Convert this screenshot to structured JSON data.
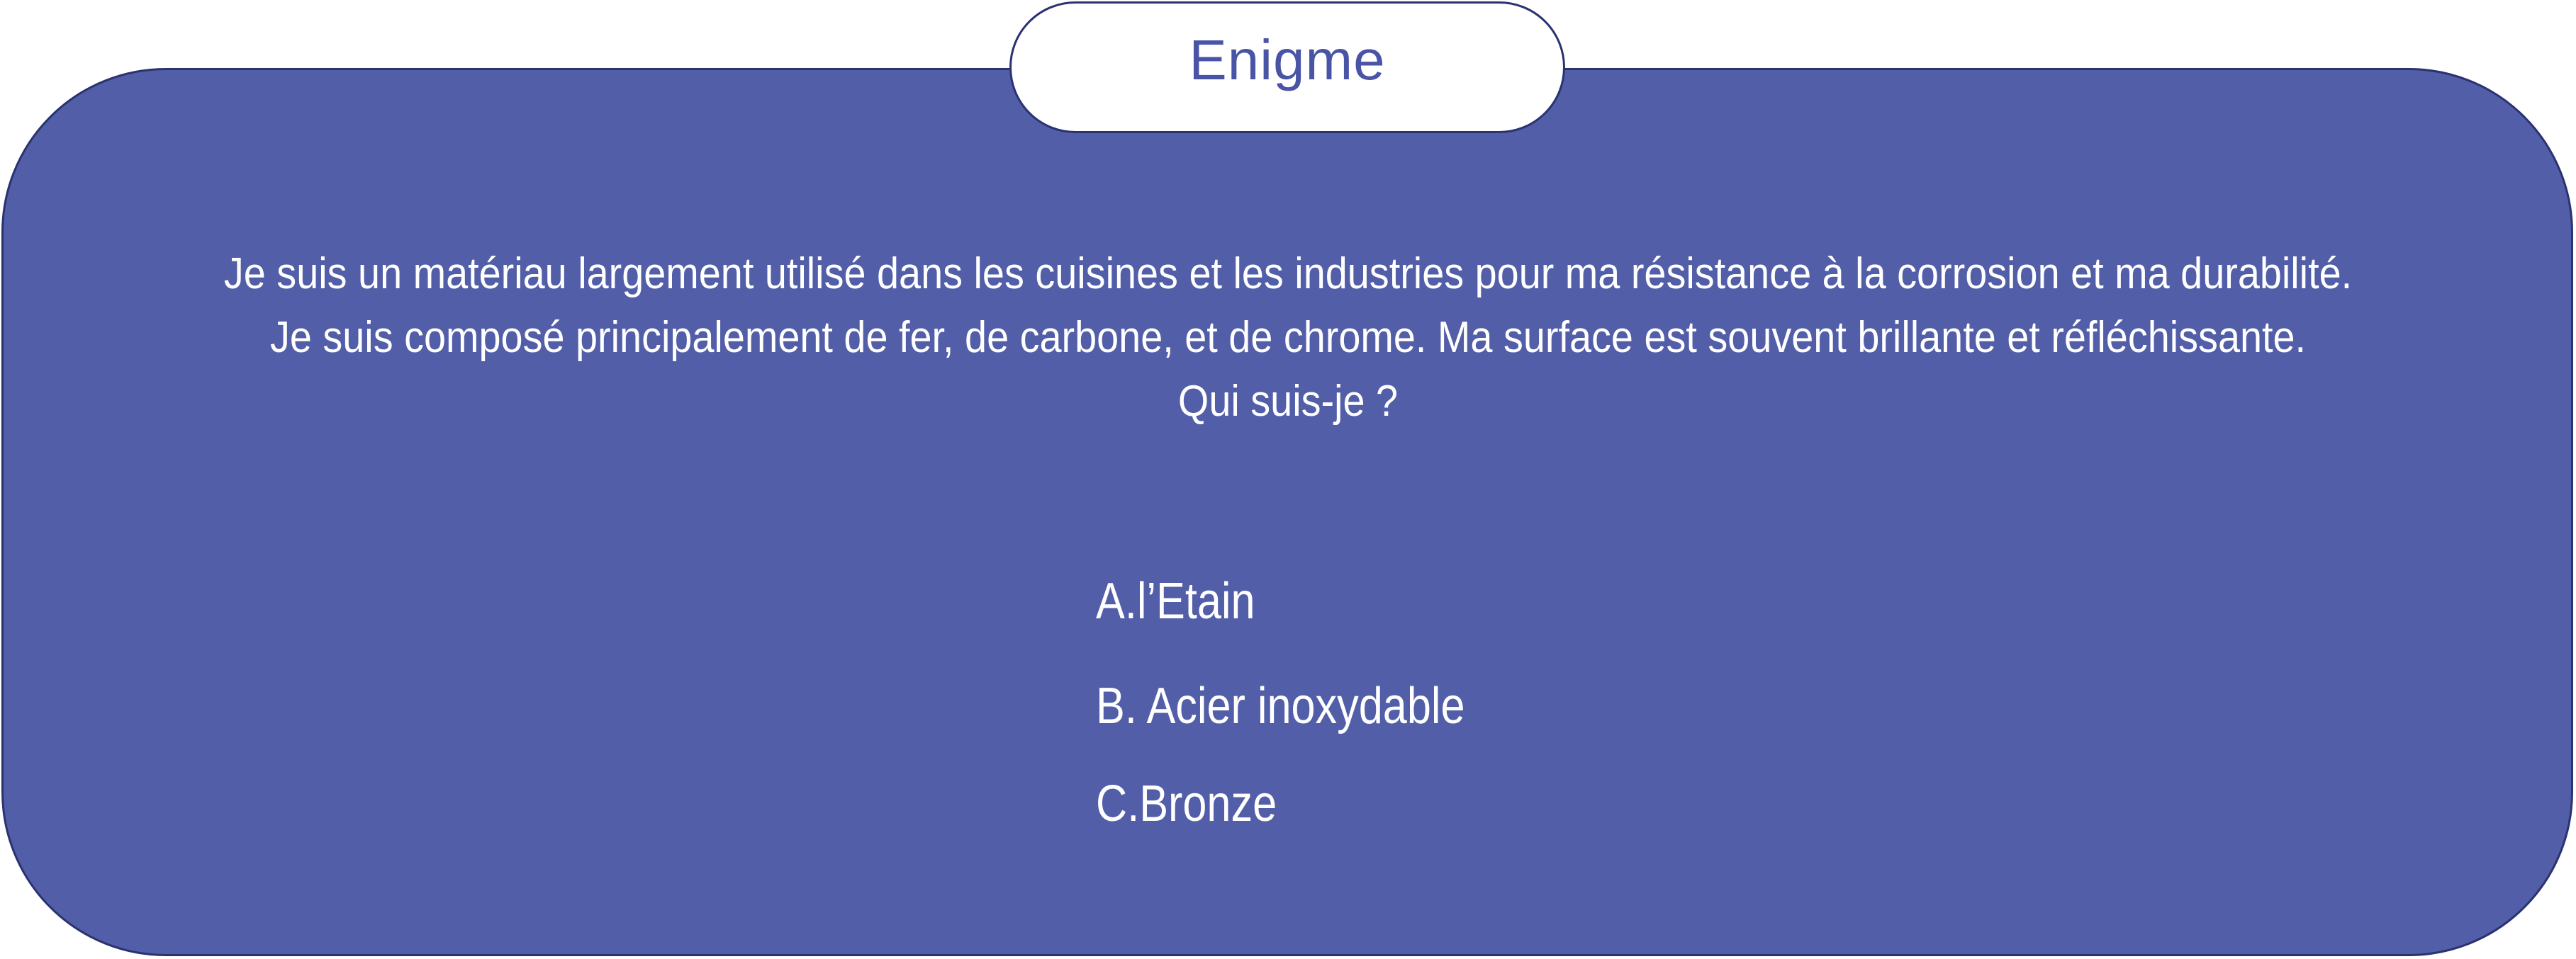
{
  "header": {
    "title": "Enigme"
  },
  "riddle": {
    "lines": [
      "Je suis un matériau largement utilisé dans les cuisines et les industries pour ma résistance à la corrosion et ma durabilité.",
      "Je suis composé principalement de fer, de carbone, et de chrome. Ma surface est souvent brillante et réfléchissante.",
      "Qui suis-je ?"
    ]
  },
  "answers": [
    {
      "label": "A.l’Etain"
    },
    {
      "label": "B. Acier inoxydable"
    },
    {
      "label": "C.Bronze"
    }
  ],
  "colors": {
    "panel": "#525ea8",
    "border": "#2a3270",
    "title_text": "#4a54a6",
    "text": "#ffffff"
  }
}
